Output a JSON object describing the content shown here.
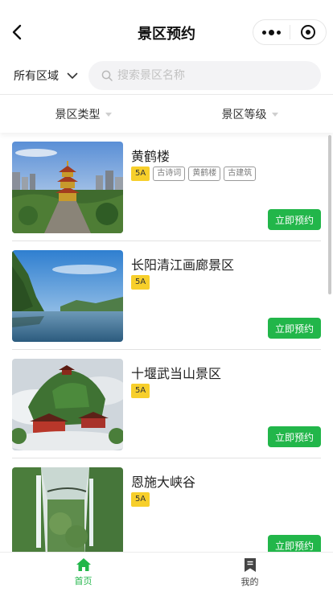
{
  "nav": {
    "title": "景区预约"
  },
  "search": {
    "region": "所有区域",
    "placeholder": "搜索景区名称"
  },
  "filters": [
    {
      "label": "景区类型"
    },
    {
      "label": "景区等级"
    }
  ],
  "items": [
    {
      "name": "黄鹤楼",
      "level": "5A",
      "tags": [
        "古诗词",
        "黄鹤楼",
        "古建筑"
      ],
      "button": "立即预约"
    },
    {
      "name": "长阳清江画廊景区",
      "level": "5A",
      "tags": [],
      "button": "立即预约"
    },
    {
      "name": "十堰武当山景区",
      "level": "5A",
      "tags": [],
      "button": "立即预约"
    },
    {
      "name": "恩施大峡谷",
      "level": "5A",
      "tags": [],
      "button": "立即预约"
    }
  ],
  "tabbar": [
    {
      "label": "首页",
      "icon": "home-icon",
      "active": true
    },
    {
      "label": "我的",
      "icon": "bookmark-icon",
      "active": false
    }
  ],
  "colors": {
    "accent": "#22b64a",
    "level_badge": "#f7cf2b"
  }
}
